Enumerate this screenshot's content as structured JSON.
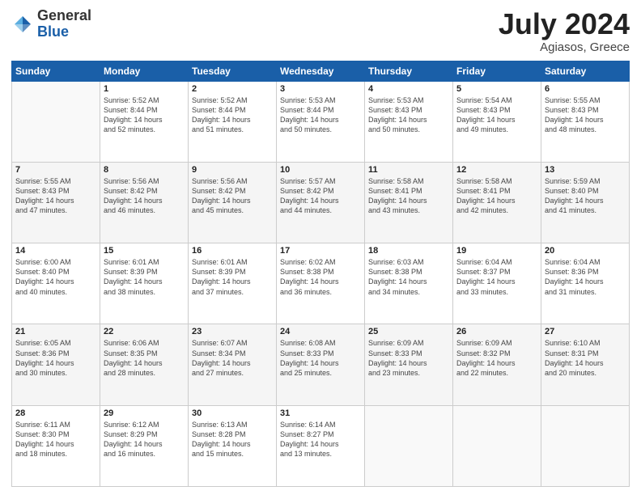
{
  "logo": {
    "general": "General",
    "blue": "Blue"
  },
  "title": {
    "month_year": "July 2024",
    "location": "Agiasos, Greece"
  },
  "weekdays": [
    "Sunday",
    "Monday",
    "Tuesday",
    "Wednesday",
    "Thursday",
    "Friday",
    "Saturday"
  ],
  "weeks": [
    [
      {
        "day": "",
        "info": ""
      },
      {
        "day": "1",
        "info": "Sunrise: 5:52 AM\nSunset: 8:44 PM\nDaylight: 14 hours\nand 52 minutes."
      },
      {
        "day": "2",
        "info": "Sunrise: 5:52 AM\nSunset: 8:44 PM\nDaylight: 14 hours\nand 51 minutes."
      },
      {
        "day": "3",
        "info": "Sunrise: 5:53 AM\nSunset: 8:44 PM\nDaylight: 14 hours\nand 50 minutes."
      },
      {
        "day": "4",
        "info": "Sunrise: 5:53 AM\nSunset: 8:43 PM\nDaylight: 14 hours\nand 50 minutes."
      },
      {
        "day": "5",
        "info": "Sunrise: 5:54 AM\nSunset: 8:43 PM\nDaylight: 14 hours\nand 49 minutes."
      },
      {
        "day": "6",
        "info": "Sunrise: 5:55 AM\nSunset: 8:43 PM\nDaylight: 14 hours\nand 48 minutes."
      }
    ],
    [
      {
        "day": "7",
        "info": "Sunrise: 5:55 AM\nSunset: 8:43 PM\nDaylight: 14 hours\nand 47 minutes."
      },
      {
        "day": "8",
        "info": "Sunrise: 5:56 AM\nSunset: 8:42 PM\nDaylight: 14 hours\nand 46 minutes."
      },
      {
        "day": "9",
        "info": "Sunrise: 5:56 AM\nSunset: 8:42 PM\nDaylight: 14 hours\nand 45 minutes."
      },
      {
        "day": "10",
        "info": "Sunrise: 5:57 AM\nSunset: 8:42 PM\nDaylight: 14 hours\nand 44 minutes."
      },
      {
        "day": "11",
        "info": "Sunrise: 5:58 AM\nSunset: 8:41 PM\nDaylight: 14 hours\nand 43 minutes."
      },
      {
        "day": "12",
        "info": "Sunrise: 5:58 AM\nSunset: 8:41 PM\nDaylight: 14 hours\nand 42 minutes."
      },
      {
        "day": "13",
        "info": "Sunrise: 5:59 AM\nSunset: 8:40 PM\nDaylight: 14 hours\nand 41 minutes."
      }
    ],
    [
      {
        "day": "14",
        "info": "Sunrise: 6:00 AM\nSunset: 8:40 PM\nDaylight: 14 hours\nand 40 minutes."
      },
      {
        "day": "15",
        "info": "Sunrise: 6:01 AM\nSunset: 8:39 PM\nDaylight: 14 hours\nand 38 minutes."
      },
      {
        "day": "16",
        "info": "Sunrise: 6:01 AM\nSunset: 8:39 PM\nDaylight: 14 hours\nand 37 minutes."
      },
      {
        "day": "17",
        "info": "Sunrise: 6:02 AM\nSunset: 8:38 PM\nDaylight: 14 hours\nand 36 minutes."
      },
      {
        "day": "18",
        "info": "Sunrise: 6:03 AM\nSunset: 8:38 PM\nDaylight: 14 hours\nand 34 minutes."
      },
      {
        "day": "19",
        "info": "Sunrise: 6:04 AM\nSunset: 8:37 PM\nDaylight: 14 hours\nand 33 minutes."
      },
      {
        "day": "20",
        "info": "Sunrise: 6:04 AM\nSunset: 8:36 PM\nDaylight: 14 hours\nand 31 minutes."
      }
    ],
    [
      {
        "day": "21",
        "info": "Sunrise: 6:05 AM\nSunset: 8:36 PM\nDaylight: 14 hours\nand 30 minutes."
      },
      {
        "day": "22",
        "info": "Sunrise: 6:06 AM\nSunset: 8:35 PM\nDaylight: 14 hours\nand 28 minutes."
      },
      {
        "day": "23",
        "info": "Sunrise: 6:07 AM\nSunset: 8:34 PM\nDaylight: 14 hours\nand 27 minutes."
      },
      {
        "day": "24",
        "info": "Sunrise: 6:08 AM\nSunset: 8:33 PM\nDaylight: 14 hours\nand 25 minutes."
      },
      {
        "day": "25",
        "info": "Sunrise: 6:09 AM\nSunset: 8:33 PM\nDaylight: 14 hours\nand 23 minutes."
      },
      {
        "day": "26",
        "info": "Sunrise: 6:09 AM\nSunset: 8:32 PM\nDaylight: 14 hours\nand 22 minutes."
      },
      {
        "day": "27",
        "info": "Sunrise: 6:10 AM\nSunset: 8:31 PM\nDaylight: 14 hours\nand 20 minutes."
      }
    ],
    [
      {
        "day": "28",
        "info": "Sunrise: 6:11 AM\nSunset: 8:30 PM\nDaylight: 14 hours\nand 18 minutes."
      },
      {
        "day": "29",
        "info": "Sunrise: 6:12 AM\nSunset: 8:29 PM\nDaylight: 14 hours\nand 16 minutes."
      },
      {
        "day": "30",
        "info": "Sunrise: 6:13 AM\nSunset: 8:28 PM\nDaylight: 14 hours\nand 15 minutes."
      },
      {
        "day": "31",
        "info": "Sunrise: 6:14 AM\nSunset: 8:27 PM\nDaylight: 14 hours\nand 13 minutes."
      },
      {
        "day": "",
        "info": ""
      },
      {
        "day": "",
        "info": ""
      },
      {
        "day": "",
        "info": ""
      }
    ]
  ]
}
